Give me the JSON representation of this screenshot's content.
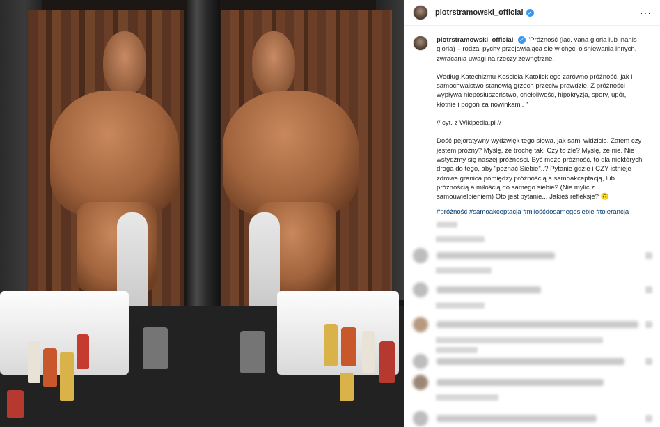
{
  "post": {
    "username": "piotrstramowski_official",
    "verified_mark": "✓",
    "more_icon": "···"
  },
  "caption": {
    "username": "piotrstramowski_official",
    "p1": "\"Próżność (łac. vana gloria lub inanis gloria) – rodzaj pychy przejawiająca się w chęci olśniewania innych, zwracania uwagi na rzeczy zewnętrzne.",
    "p2": "Według Katechizmu Kościoła Katolickiego zarówno próżność, jak i samochwalstwo stanowią grzech przeciw prawdzie. Z próżności wypływa nieposłuszeństwo, chełpliwość, hipokryzja, spory, upór, kłótnie i pogoń za nowinkami. \"",
    "p3": "// cyt. z Wikipedia.pl //",
    "p4": "Dość pejoratywny wydźwięk tego słowa, jak sami widzicie. Zatem czy jestem próżny? Myślę, że trochę tak. Czy to źle? Myślę, że nie. Nie wstydźmy się naszej próżności. Być może próżność, to dla niektórych droga do tego, aby \"poznać Siebie\"..? Pytanie gdzie i CZY istnieje zdrowa granica pomiędzy próżnością a samoakceptacją, lub próżnością a miłością do samego siebie? (Nie mylić z samouwielbieniem) Oto jest pytanie... Jakieś refleksje? 🙃",
    "hashtags": "#próżność #samoakceptacja #miłośćdosamegosiebie #tolerancja"
  },
  "icons": {
    "more": "ellipsis-icon",
    "verified": "verified-badge-icon"
  }
}
